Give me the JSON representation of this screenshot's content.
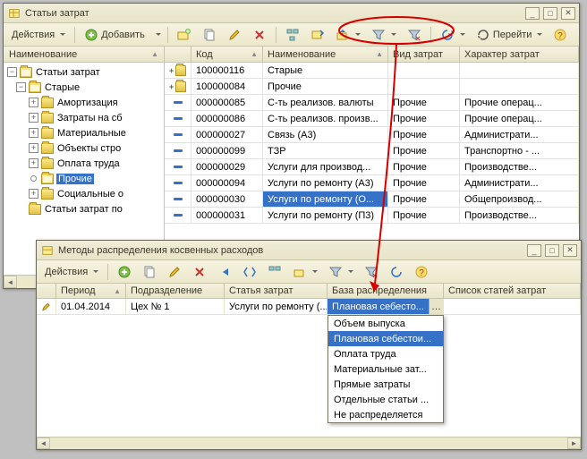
{
  "win1": {
    "title": "Статьи затрат",
    "actions_label": "Действия",
    "add_label": "Добавить",
    "goto_label": "Перейти",
    "tree_header": "Наименование",
    "tree_root": "Статьи затрат",
    "tree_children": [
      {
        "label": "Старые",
        "open": true
      },
      {
        "label": "Амортизация"
      },
      {
        "label": "Затраты на сб"
      },
      {
        "label": "Материальные"
      },
      {
        "label": "Объекты стро"
      },
      {
        "label": "Оплата труда"
      },
      {
        "label": "Прочие",
        "selected": true
      },
      {
        "label": "Социальные о"
      },
      {
        "label": "Статьи затрат по"
      }
    ],
    "cols": {
      "code": "Код",
      "name": "Наименование",
      "vid": "Вид затрат",
      "har": "Характер затрат"
    },
    "rows": [
      {
        "mark": "folder",
        "plus": true,
        "code": "100000116",
        "name": "Старые",
        "vid": "",
        "har": ""
      },
      {
        "mark": "folder",
        "plus": true,
        "code": "100000084",
        "name": "Прочие",
        "vid": "",
        "har": ""
      },
      {
        "mark": "dash",
        "code": "000000085",
        "name": "С-ть реализов. валюты",
        "vid": "Прочие",
        "har": "Прочие операц..."
      },
      {
        "mark": "dash",
        "code": "000000086",
        "name": "С-ть реализов. произв...",
        "vid": "Прочие",
        "har": "Прочие операц..."
      },
      {
        "mark": "dash",
        "code": "000000027",
        "name": "Связь (А3)",
        "vid": "Прочие",
        "har": "Администрати..."
      },
      {
        "mark": "dash",
        "code": "000000099",
        "name": "ТЗР",
        "vid": "Прочие",
        "har": "Транспортно - ..."
      },
      {
        "mark": "dash",
        "code": "000000029",
        "name": "Услуги для производ...",
        "vid": "Прочие",
        "har": "Производстве..."
      },
      {
        "mark": "dash",
        "code": "000000094",
        "name": "Услуги по ремонту (А3)",
        "vid": "Прочие",
        "har": "Администрати..."
      },
      {
        "mark": "dash",
        "sel": "name",
        "code": "000000030",
        "name": "Услуги по ремонту (О...",
        "vid": "Прочие",
        "har": "Общепроизвод..."
      },
      {
        "mark": "dash",
        "code": "000000031",
        "name": "Услуги по ремонту (П3)",
        "vid": "Прочие",
        "har": "Производстве..."
      }
    ]
  },
  "win2": {
    "title": "Методы распределения косвенных расходов",
    "actions_label": "Действия",
    "cols": {
      "period": "Период",
      "podr": "Подразделение",
      "statya": "Статья затрат",
      "baza": "База распределения",
      "spisok": "Список статей затрат"
    },
    "row": {
      "period": "01.04.2014",
      "podr": "Цех № 1",
      "statya": "Услуги по ремонту (...",
      "baza": "Плановая себесто..."
    },
    "dropdown": [
      "Объем выпуска",
      "Плановая себестои...",
      "Оплата труда",
      "Материальные зат...",
      "Прямые затраты",
      "Отдельные статьи ...",
      "Не распределяется"
    ],
    "dropdown_sel": 1
  }
}
